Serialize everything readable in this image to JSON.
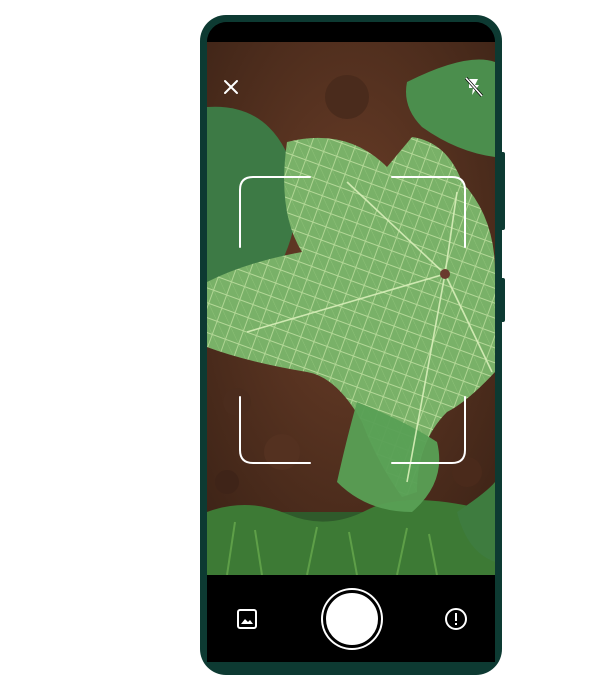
{
  "app": {
    "screen": "plant-identification-camera"
  },
  "top_bar": {
    "close_icon": "close-icon",
    "flash_icon": "flash-off-icon"
  },
  "viewfinder": {
    "frame_color": "#ffffff",
    "subject": "leaf"
  },
  "bottom_bar": {
    "gallery_icon": "image-gallery-icon",
    "shutter_icon": "shutter-button",
    "info_icon": "info-alert-icon"
  },
  "colors": {
    "device_frame": "#0d3a32",
    "leaf": "#7fb56f",
    "soil": "#5a3524",
    "background": "#ffffff"
  }
}
